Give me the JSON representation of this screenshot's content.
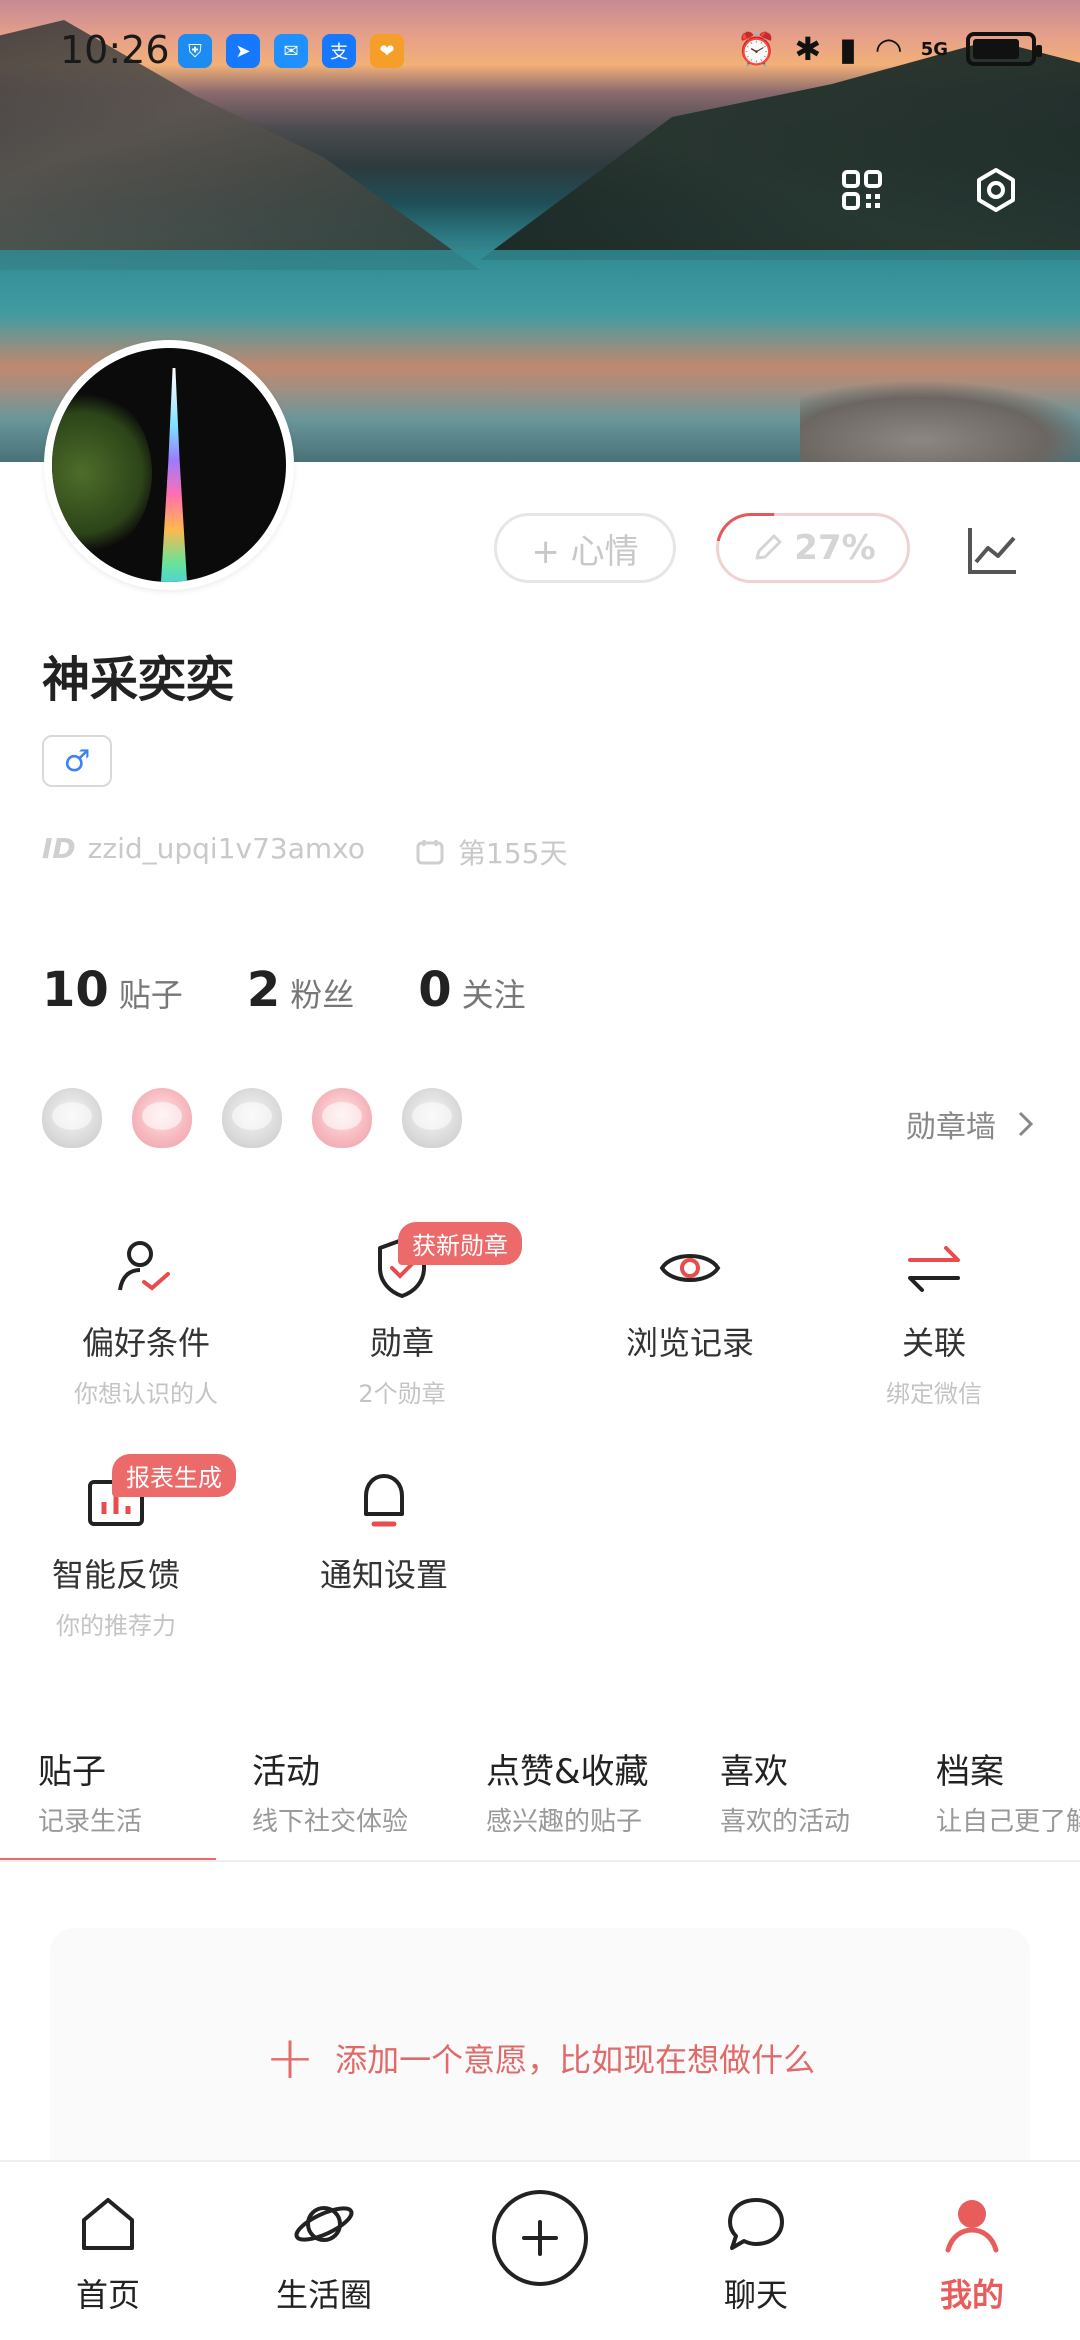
{
  "status_bar": {
    "time": "10:26",
    "network": "5G"
  },
  "profile": {
    "nickname": "神采奕奕",
    "gender_symbol": "♂",
    "id_label": "ID",
    "user_id": "zzid_upqi1v73amxo",
    "days": "第155天",
    "mood_button": "+ 心情",
    "completion": "27%",
    "counts": [
      {
        "num": "10",
        "label": "贴子"
      },
      {
        "num": "2",
        "label": "粉丝"
      },
      {
        "num": "0",
        "label": "关注"
      }
    ],
    "medal_wall": "勋章墙"
  },
  "functions": [
    {
      "title": "偏好条件",
      "sub": "你想认识的人",
      "icon": "person-check-icon"
    },
    {
      "title": "勋章",
      "sub": "2个勋章",
      "icon": "shield-check-icon",
      "badge": "获新勋章"
    },
    {
      "title": "浏览记录",
      "sub": "",
      "icon": "eye-icon"
    },
    {
      "title": "关联",
      "sub": "绑定微信",
      "icon": "swap-arrows-icon"
    },
    {
      "title": "智能反馈",
      "sub": "你的推荐力",
      "icon": "bar-chart-icon",
      "badge": "报表生成"
    },
    {
      "title": "通知设置",
      "sub": "",
      "icon": "bell-icon"
    }
  ],
  "tabs": [
    {
      "title": "贴子",
      "sub": "记录生活"
    },
    {
      "title": "活动",
      "sub": "线下社交体验"
    },
    {
      "title": "点赞&收藏",
      "sub": "感兴趣的贴子"
    },
    {
      "title": "喜欢",
      "sub": "喜欢的活动"
    },
    {
      "title": "档案",
      "sub": "让自己更了解"
    }
  ],
  "wish_prompt": "添加一个意愿，比如现在想做什么",
  "bottom_nav": [
    {
      "label": "首页"
    },
    {
      "label": "生活圈"
    },
    {
      "label": "聊天"
    },
    {
      "label": "我的"
    }
  ],
  "colors": {
    "accent": "#e85c5c",
    "badge": "#ec6a6a",
    "gender_blue": "#3b82f6"
  }
}
